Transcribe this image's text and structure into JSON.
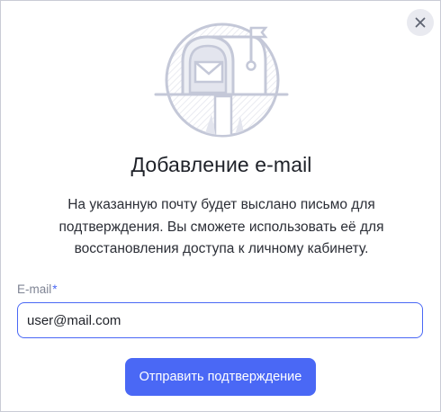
{
  "dialog": {
    "title": "Добавление e-mail",
    "description": "На указанную почту будет выслано письмо для подтверждения. Вы сможете использовать её для восстановления доступа к личному кабинету.",
    "close_icon": "close-icon",
    "illustration_icon": "mailbox-icon"
  },
  "email_field": {
    "label": "E-mail",
    "required_mark": "*",
    "value": "user@mail.com"
  },
  "submit_button": {
    "label": "Отправить подтверждение"
  },
  "colors": {
    "accent": "#4a68f5",
    "background": "#ffffff",
    "illustration": "#c4c8d8"
  }
}
